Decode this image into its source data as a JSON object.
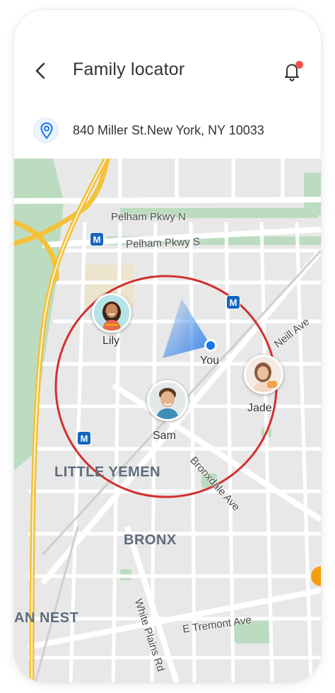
{
  "header": {
    "title": "Family locator",
    "address": "840 Miller St.New York, NY 10033",
    "has_notification": true
  },
  "map": {
    "streets": {
      "pelham_n": "Pelham Pkwy N",
      "pelham_s": "Pelham Pkwy S",
      "neill": "Neill Ave",
      "bronxdale": "Bronxdale Ave",
      "white_plains": "White Plains Rd",
      "tremont": "E Tremont Ave"
    },
    "areas": {
      "little_yemen": "LITTLE YEMEN",
      "bronx": "BRONX",
      "nest": "AN NEST"
    },
    "metro_label": "M",
    "you_label": "You",
    "members": [
      {
        "name": "Lily"
      },
      {
        "name": "Jade"
      },
      {
        "name": "Sam"
      }
    ]
  },
  "colors": {
    "geofence": "#d32f2f",
    "you_dot": "#1a73e8",
    "metro": "#1565c0",
    "notification": "#ef5350",
    "highway": "#f6c343",
    "park": "#bcdcbf"
  }
}
